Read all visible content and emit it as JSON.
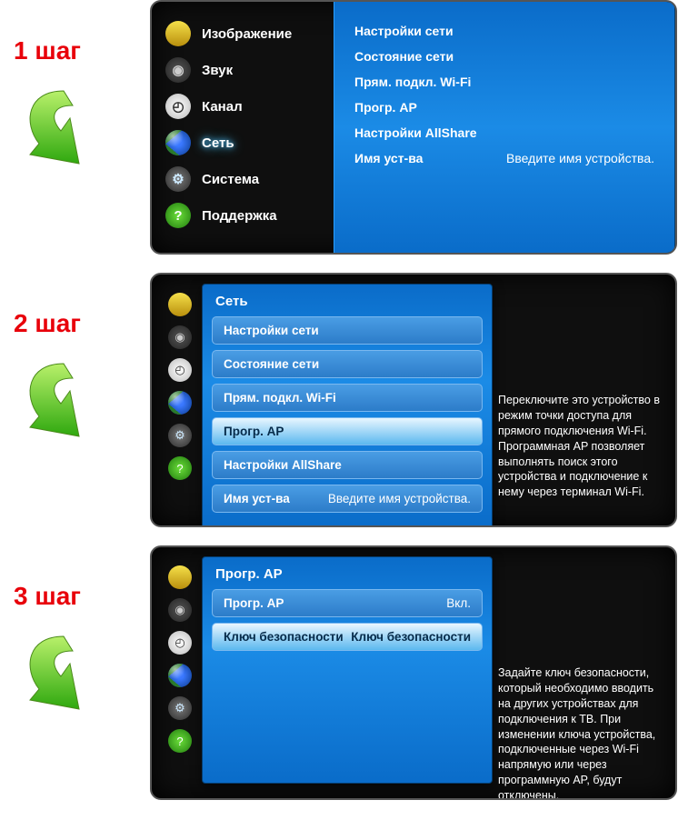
{
  "steps": {
    "s1_label": "1 шаг",
    "s2_label": "2 шаг",
    "s3_label": "3 шаг"
  },
  "main_menu": {
    "picture": "Изображение",
    "sound": "Звук",
    "channel": "Канал",
    "network": "Сеть",
    "system": "Система",
    "support": "Поддержка"
  },
  "network_sub": {
    "net_settings": "Настройки сети",
    "net_status": "Состояние сети",
    "wifi_direct": "Прям. подкл. Wi-Fi",
    "soft_ap": "Прогр. AP",
    "allshare": "Настройки AllShare",
    "dev_name_label": "Имя уст-ва",
    "dev_name_hint": "Введите имя устройства."
  },
  "step2": {
    "panel_title": "Сеть",
    "help_text": "Переключите это устройство в режим точки доступа для прямого подключения Wi-Fi. Программная AP позволяет выполнять поиск этого устройства и подключение к нему через терминал Wi-Fi."
  },
  "step3": {
    "panel_title": "Прогр. AP",
    "row1_label": "Прогр. AP",
    "row1_value": "Вкл.",
    "row2_label": "Ключ безопасности",
    "row2_value": "Ключ безопасности",
    "help_text": "Задайте ключ безопасности, который необходимо вводить на других устройствах для подключения к ТВ. При изменении ключа устройства, подключенные через Wi-Fi напрямую или через программную AP, будут отключены."
  }
}
